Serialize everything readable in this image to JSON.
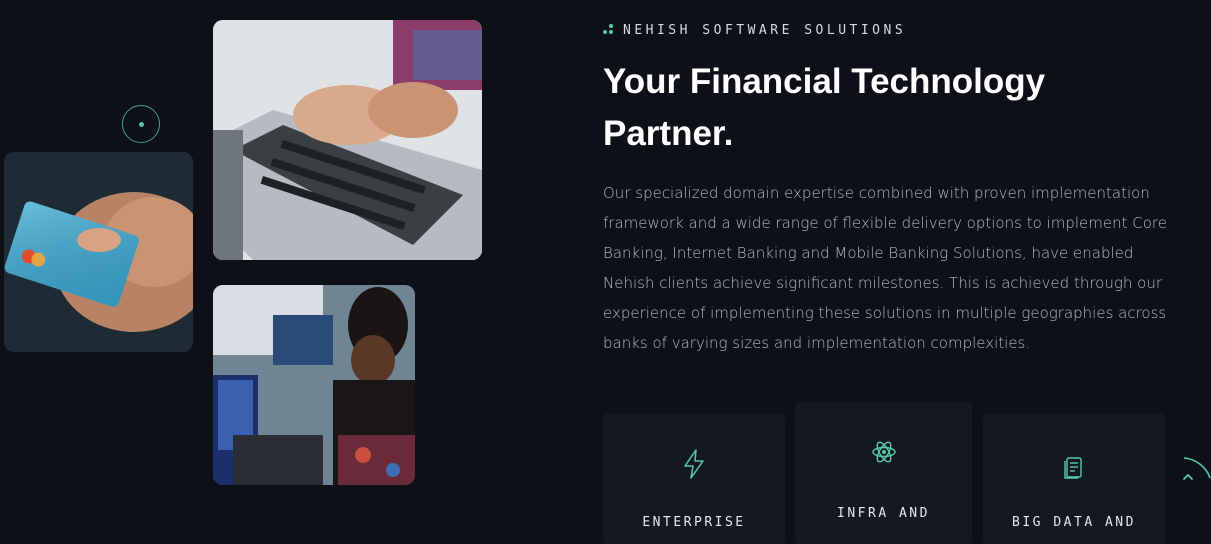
{
  "section": {
    "eyebrow": "NEHISH SOFTWARE SOLUTIONS",
    "title_line1": "Your Financial Technology",
    "title_line2": "Partner.",
    "description": "Our specialized domain expertise combined with proven implementation framework and a wide range of flexible delivery options to implement Core Banking, Internet Banking and Mobile Banking Solutions, have enabled Nehish clients achieve significant milestones. This is achieved through our experience of implementing these solutions in multiple geographies across banks of varying sizes and implementation complexities."
  },
  "images": [
    {
      "icon": "hand-holding-card-photo"
    },
    {
      "icon": "typing-on-laptop-photo"
    },
    {
      "icon": "woman-working-on-laptop-photo"
    }
  ],
  "cards": [
    {
      "label": "ENTERPRISE",
      "icon": "lightning-icon"
    },
    {
      "label": "INFRA AND",
      "icon": "atom-icon"
    },
    {
      "label": "BIG DATA AND",
      "icon": "document-icon"
    }
  ],
  "colors": {
    "background": "#0d1017",
    "accent": "#58c9a6",
    "card": "#141921",
    "text_muted": "#b5bcc4"
  }
}
